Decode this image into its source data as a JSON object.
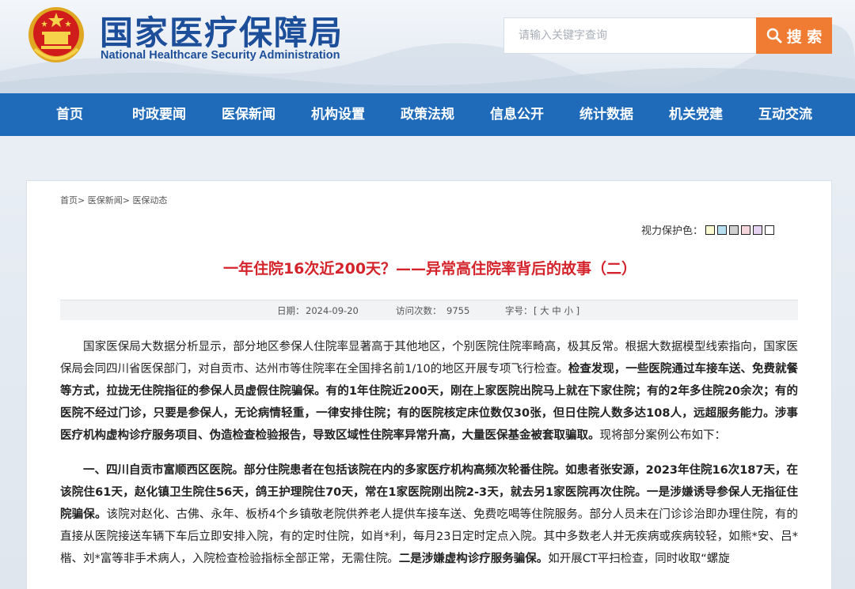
{
  "header": {
    "title": "国家医疗保障局",
    "subtitle": "National Healthcare Security Administration",
    "search_placeholder": "请输入关键字查询",
    "search_button": "搜 索"
  },
  "nav": {
    "items": [
      "首页",
      "时政要闻",
      "医保新闻",
      "机构设置",
      "政策法规",
      "信息公开",
      "统计数据",
      "机关党建",
      "互动交流"
    ]
  },
  "breadcrumb": [
    "首页>",
    "医保新闻>",
    "医保动态"
  ],
  "vision": {
    "label": "视力保护色：",
    "colors": [
      "#fafad2",
      "#b8e0f0",
      "#d0d0d0",
      "#f3d6dc",
      "#e6d3f2",
      "#ffffff"
    ]
  },
  "article": {
    "title": "一年住院16次近200天？——异常高住院率背后的故事（二）",
    "date_label": "日期：",
    "date": "2024-09-20",
    "visits_label": "访问次数：",
    "visits": "9755",
    "fontsize_label": "字号：",
    "fontsize_options": "[ 大 中 小 ]",
    "p1_a": "国家医保局大数据分析显示，部分地区参保人住院率显著高于其他地区，个别医院住院率畸高，极其反常。根据大数据模型线索指向，国家医保局会同四川省医保部门，对自贡市、达州市等住院率在全国排名前1/10的地区开展专项飞行检查。",
    "p1_b": "检查发现，一些医院通过车接车送、免费就餐等方式，拉拢无住院指征的参保人员虚假住院骗保。有的1年住院近200天，刚在上家医院出院马上就在下家住院；有的2年多住院20余次；有的医院不经过门诊，只要是参保人，无论病情轻重，一律安排住院；有的医院核定床位数仅30张，但日住院人数多达108人，远超服务能力。涉事医疗机构虚构诊疗服务项目、伪造检查检验报告，导致区域性住院率异常升高，大量医保基金被套取骗取。",
    "p1_c": "现将部分案例公布如下：",
    "p2_a": "一、四川自贡市富顺西区医院。部分住院患者在包括该院在内的多家医疗机构高频次轮番住院。如患者张安源，2023年住院16次187天，在该院住61天，赵化镇卫生院住56天，鸽王护理院住70天，常在1家医院刚出院2-3天，就去另1家医院再次住院。一是涉嫌诱导参保人无指征住院骗保。",
    "p2_b": "该院对赵化、古佛、永年、板桥4个乡镇敬老院供养老人提供车接车送、免费吃喝等住院服务。部分人员未在门诊诊治即办理住院，有的直接从医院接送车辆下车后立即安排入院，有的定时住院，如肖*利，每月23日定时定点入院。其中多数老人并无疾病或疾病较轻，如熊*安、吕*楷、刘*富等非手术病人，入院检查检验指标全部正常，无需住院。",
    "p2_c": "二是涉嫌虚构诊疗服务骗保。",
    "p2_d": "如开展CT平扫检查，同时收取“螺旋"
  }
}
